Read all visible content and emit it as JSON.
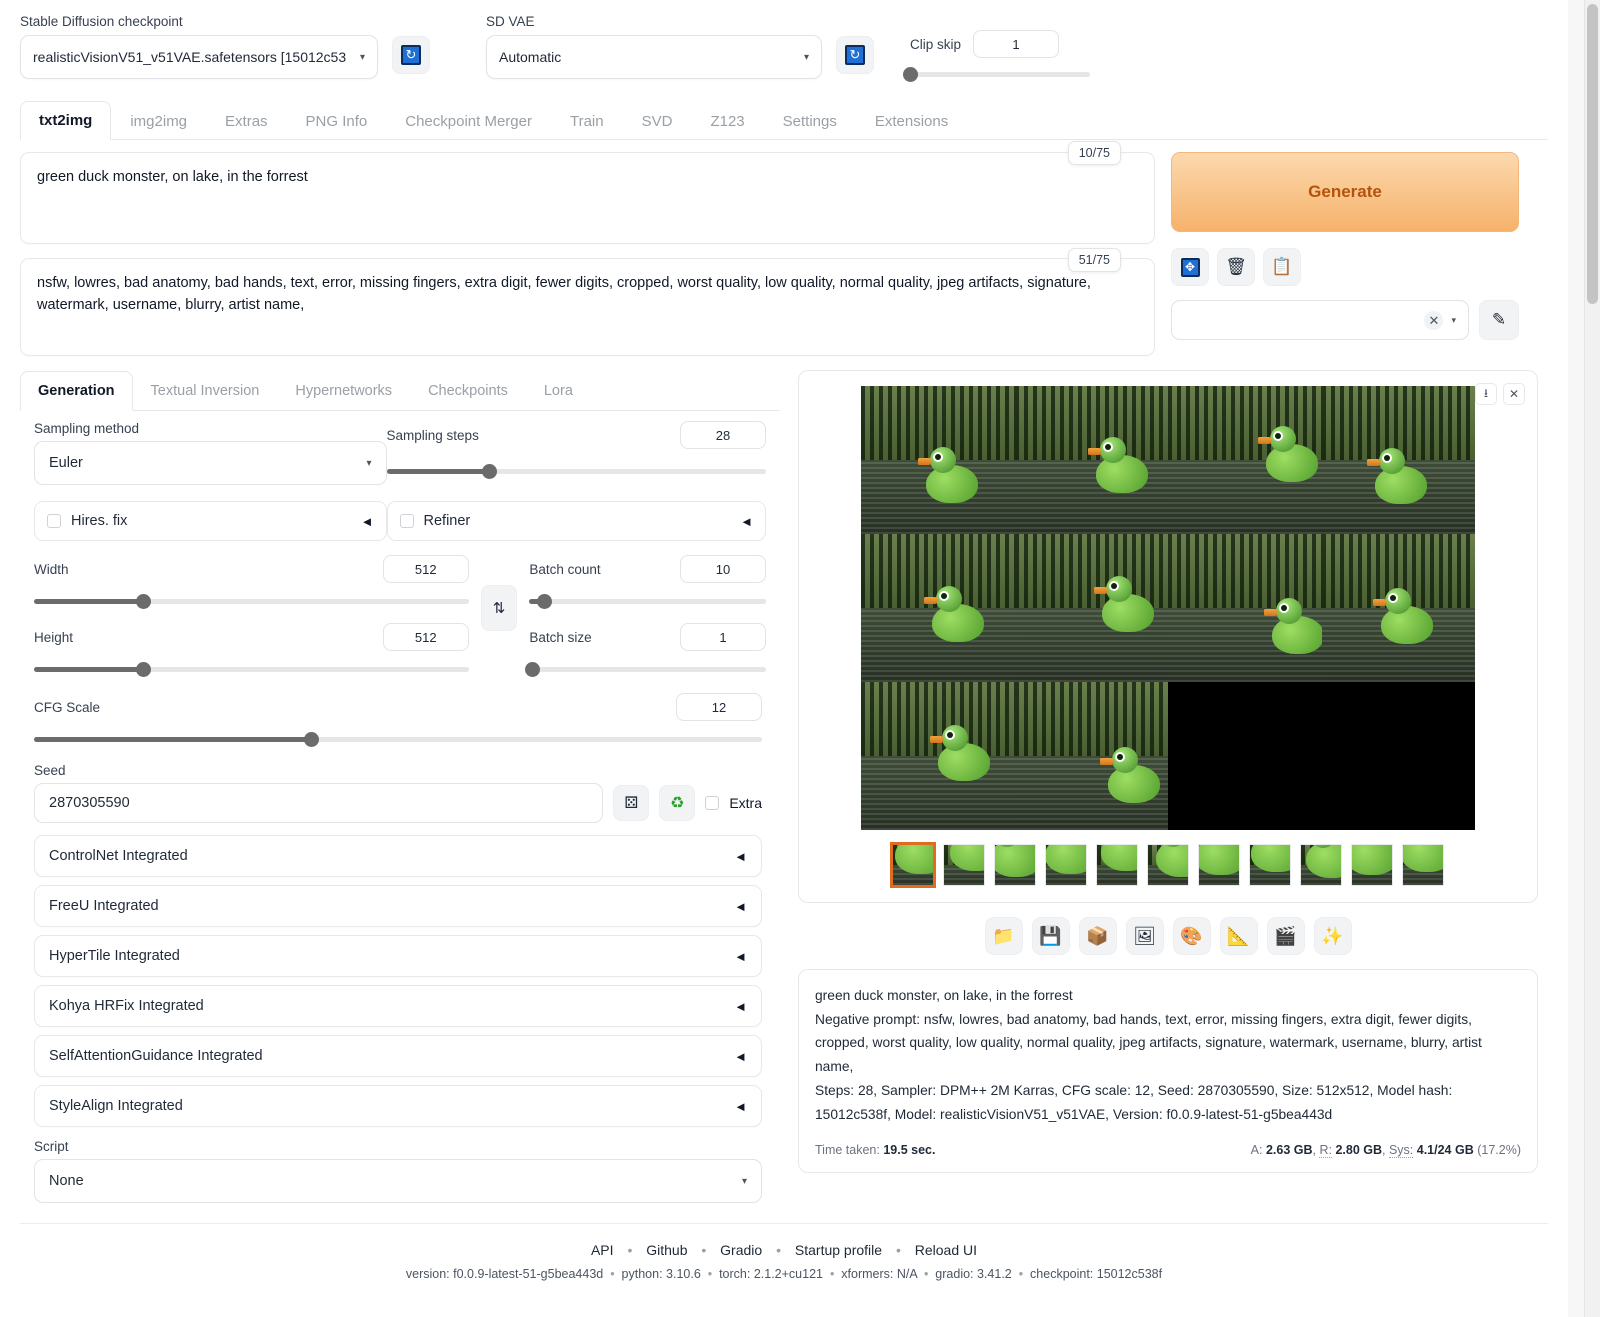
{
  "top": {
    "checkpoint_label": "Stable Diffusion checkpoint",
    "checkpoint_value": "realisticVisionV51_v51VAE.safetensors [15012c53",
    "vae_label": "SD VAE",
    "vae_value": "Automatic",
    "clip_skip_label": "Clip skip",
    "clip_skip_value": "1",
    "refresh_icon": "refresh-icon"
  },
  "tabs": [
    {
      "label": "txt2img",
      "active": true
    },
    {
      "label": "img2img",
      "active": false
    },
    {
      "label": "Extras",
      "active": false
    },
    {
      "label": "PNG Info",
      "active": false
    },
    {
      "label": "Checkpoint Merger",
      "active": false
    },
    {
      "label": "Train",
      "active": false
    },
    {
      "label": "SVD",
      "active": false
    },
    {
      "label": "Z123",
      "active": false
    },
    {
      "label": "Settings",
      "active": false
    },
    {
      "label": "Extensions",
      "active": false
    }
  ],
  "prompt": {
    "positive": "green duck monster, on lake, in the forrest",
    "positive_tokens": "10/75",
    "negative": "nsfw, lowres, bad anatomy, bad hands, text, error, missing fingers, extra digit, fewer digits, cropped, worst quality, low quality, normal quality, jpeg artifacts, signature, watermark, username, blurry, artist name,",
    "negative_tokens": "51/75"
  },
  "actions": {
    "generate_label": "Generate",
    "generate_color": "#f6b26b",
    "mini_buttons": [
      {
        "name": "arrow-into-box-icon",
        "glyph": "↙"
      },
      {
        "name": "trash-icon",
        "glyph": "🗑"
      },
      {
        "name": "clipboard-icon",
        "glyph": "📋"
      }
    ],
    "styles_value": "",
    "styles_clear_icon": "close-icon",
    "edit_styles_icon": "pencil-icon"
  },
  "subtabs": [
    {
      "label": "Generation",
      "active": true
    },
    {
      "label": "Textual Inversion",
      "active": false
    },
    {
      "label": "Hypernetworks",
      "active": false
    },
    {
      "label": "Checkpoints",
      "active": false
    },
    {
      "label": "Lora",
      "active": false
    }
  ],
  "params": {
    "sampling_method_label": "Sampling method",
    "sampling_method_value": "Euler",
    "sampling_steps_label": "Sampling steps",
    "sampling_steps_value": "28",
    "sampling_steps_pct": 27,
    "hires_fix_label": "Hires. fix",
    "refiner_label": "Refiner",
    "width_label": "Width",
    "width_value": "512",
    "width_pct": 25,
    "height_label": "Height",
    "height_value": "512",
    "height_pct": 25,
    "batch_count_label": "Batch count",
    "batch_count_value": "10",
    "batch_count_pct": 5,
    "batch_size_label": "Batch size",
    "batch_size_value": "1",
    "batch_size_pct": 0,
    "cfg_label": "CFG Scale",
    "cfg_value": "12",
    "cfg_pct": 38,
    "seed_label": "Seed",
    "seed_value": "2870305590",
    "extra_label": "Extra",
    "dice_icon": "dice-icon",
    "recycle_icon": "recycle-icon",
    "swap_icon": "swap-dimensions-icon",
    "script_label": "Script",
    "script_value": "None"
  },
  "accordions": [
    "ControlNet Integrated",
    "FreeU Integrated",
    "HyperTile Integrated",
    "Kohya HRFix Integrated",
    "SelfAttentionGuidance Integrated",
    "StyleAlign Integrated"
  ],
  "gallery": {
    "download_icon": "download-icon",
    "close_icon": "close-icon",
    "cells": [
      {
        "black": false
      },
      {
        "black": false
      },
      {
        "black": false
      },
      {
        "black": false
      },
      {
        "black": false
      },
      {
        "black": false
      },
      {
        "black": false
      },
      {
        "black": false
      },
      {
        "black": false
      },
      {
        "black": false
      },
      {
        "black": true
      },
      {
        "black": true
      }
    ],
    "thumbnails": [
      {
        "selected": true
      },
      {
        "selected": false
      },
      {
        "selected": false
      },
      {
        "selected": false
      },
      {
        "selected": false
      },
      {
        "selected": false
      },
      {
        "selected": false
      },
      {
        "selected": false
      },
      {
        "selected": false
      },
      {
        "selected": false
      },
      {
        "selected": false
      }
    ],
    "toolbar": [
      {
        "name": "open-folder-icon",
        "glyph": "📁"
      },
      {
        "name": "save-icon",
        "glyph": "💾"
      },
      {
        "name": "save-zip-icon",
        "glyph": "📦"
      },
      {
        "name": "send-to-img2img-icon",
        "glyph": "🖼"
      },
      {
        "name": "send-to-inpaint-icon",
        "glyph": "🎨"
      },
      {
        "name": "send-to-extras-icon",
        "glyph": "📐"
      },
      {
        "name": "send-to-svd-icon",
        "glyph": "🎬"
      },
      {
        "name": "send-to-z123-icon",
        "glyph": "✨"
      }
    ]
  },
  "info": {
    "prompt_line": "green duck monster, on lake, in the forrest",
    "negative_line": "Negative prompt: nsfw, lowres, bad anatomy, bad hands, text, error, missing fingers, extra digit, fewer digits, cropped, worst quality, low quality, normal quality, jpeg artifacts, signature, watermark, username, blurry, artist name,",
    "params_line": "Steps: 28, Sampler: DPM++ 2M Karras, CFG scale: 12, Seed: 2870305590, Size: 512x512, Model hash: 15012c538f, Model: realisticVisionV51_v51VAE, Version: f0.0.9-latest-51-g5bea443d",
    "time_label": "Time taken:",
    "time_value": "19.5 sec.",
    "mem_a_label": "A:",
    "mem_a_value": "2.63 GB",
    "mem_r_label": "R:",
    "mem_r_value": "2.80 GB",
    "mem_sys_label": "Sys:",
    "mem_sys_value": "4.1/24 GB",
    "mem_sys_pct": "(17.2%)"
  },
  "footer": {
    "links": [
      "API",
      "Github",
      "Gradio",
      "Startup profile",
      "Reload UI"
    ],
    "version_line": "version: f0.0.9-latest-51-g5bea443d",
    "python_line": "python: 3.10.6",
    "torch_line": "torch: 2.1.2+cu121",
    "xformers_line": "xformers: N/A",
    "gradio_line": "gradio: 3.41.2",
    "checkpoint_line": "checkpoint: 15012c538f"
  }
}
